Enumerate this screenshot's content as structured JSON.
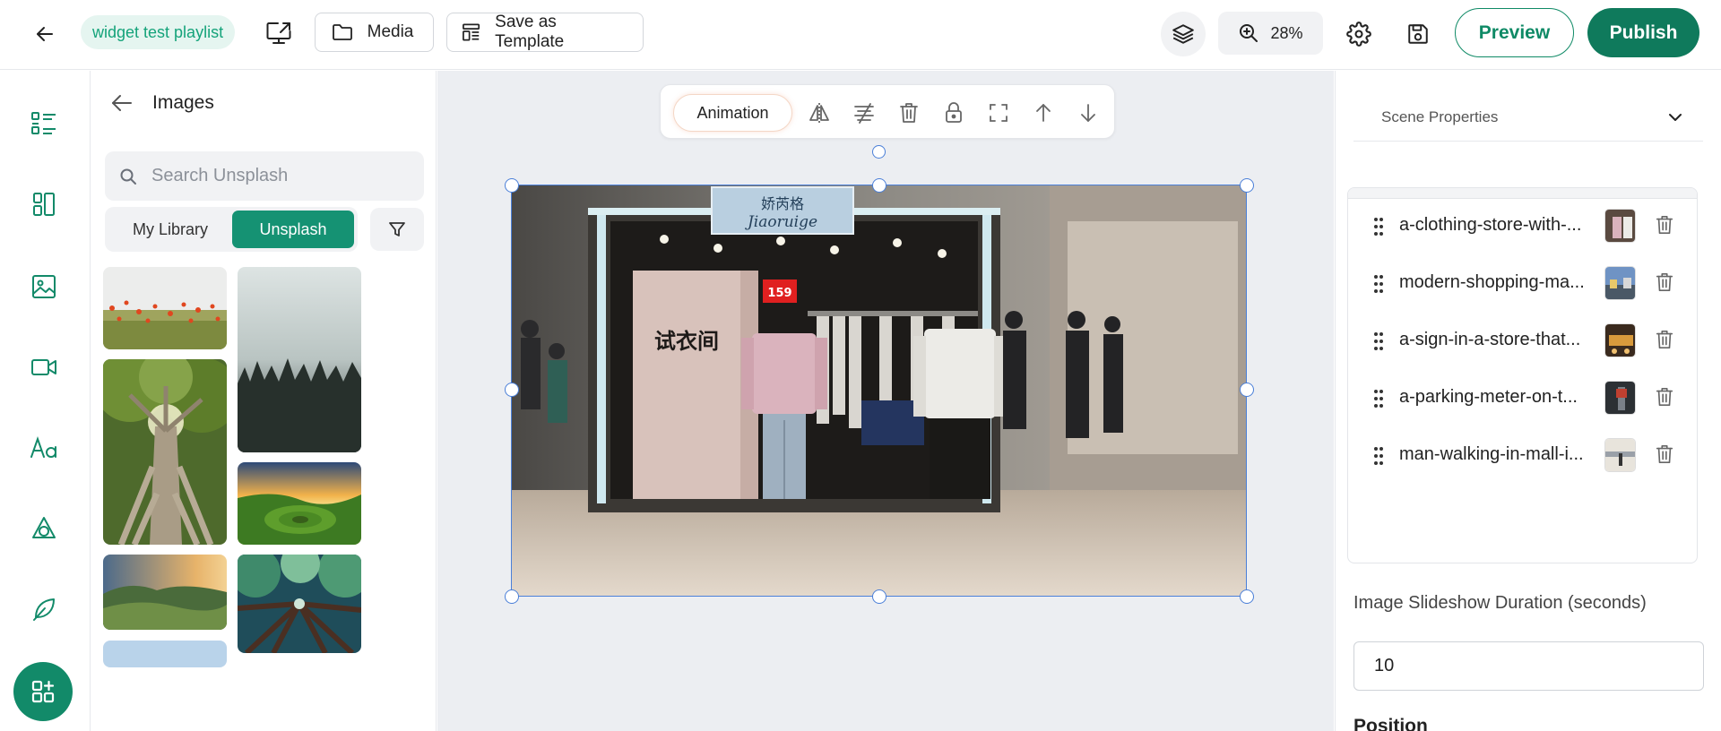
{
  "header": {
    "playlist_name": "widget test playlist",
    "media_label": "Media",
    "template_label": "Save as Template",
    "zoom": "28%",
    "preview_label": "Preview",
    "publish_label": "Publish"
  },
  "rail": {
    "items": [
      "list-icon",
      "layout-icon",
      "image-icon",
      "video-icon",
      "text-icon",
      "shapes-icon",
      "leaf-icon"
    ],
    "apps": "apps-icon"
  },
  "panel": {
    "title": "Images",
    "search_placeholder": "Search Unsplash",
    "tabs": [
      "My Library",
      "Unsplash"
    ],
    "active_tab": "Unsplash"
  },
  "canvas": {
    "animation_label": "Animation",
    "photo_sign_brand": "娇芮格",
    "photo_sign_script": "Jiaoruige",
    "photo_booth_text": "试衣间",
    "photo_price_tag": "159"
  },
  "properties": {
    "section_title": "Scene Properties",
    "images": [
      {
        "name": "a-clothing-store-with-..."
      },
      {
        "name": "modern-shopping-ma..."
      },
      {
        "name": "a-sign-in-a-store-that..."
      },
      {
        "name": "a-parking-meter-on-t..."
      },
      {
        "name": "man-walking-in-mall-i..."
      }
    ],
    "duration_label": "Image Slideshow Duration (seconds)",
    "duration_value": "10",
    "position_label": "Position"
  },
  "colors": {
    "brand_green": "#0f7a5c",
    "accent_green": "#159273",
    "selection_blue": "#4a7fd8"
  }
}
